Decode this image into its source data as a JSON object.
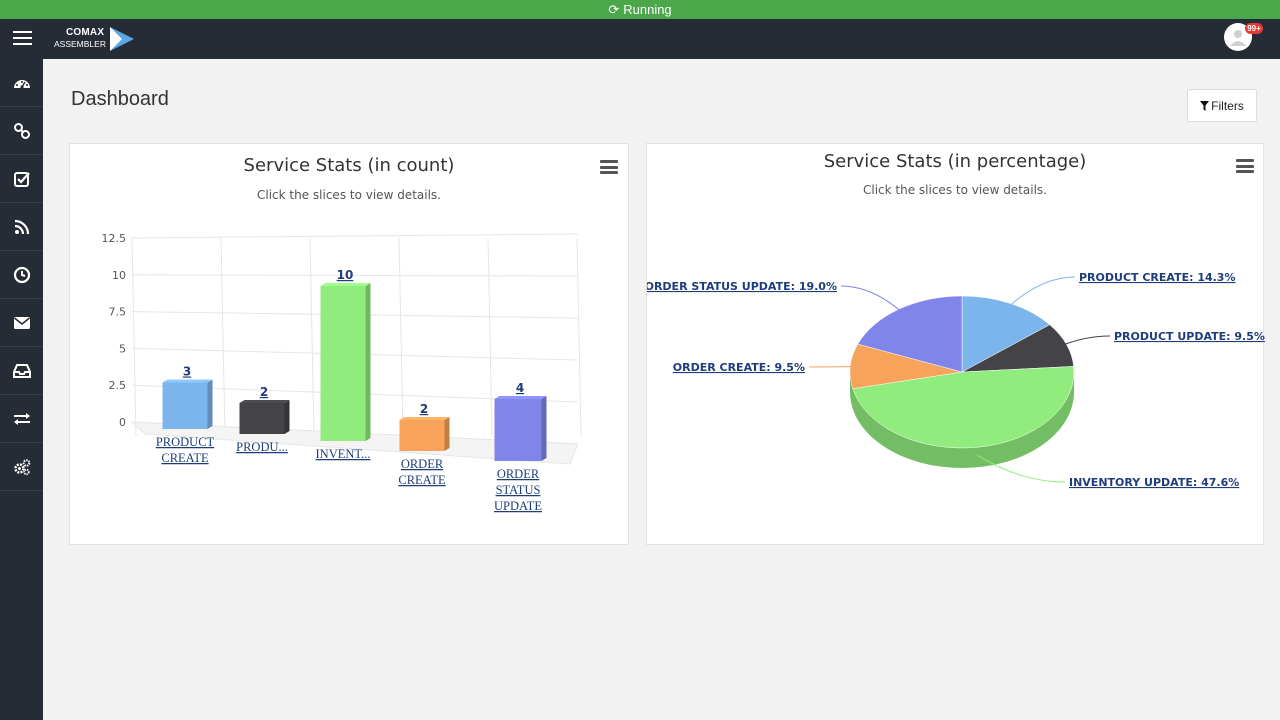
{
  "status": {
    "label": "Running"
  },
  "header": {
    "logo_line1": "COMAX",
    "logo_line2": "ASSEMBLER",
    "notification_count": "99+"
  },
  "sidebar": {
    "items": [
      "dashboard-icon",
      "link-icon",
      "check-square-icon",
      "rss-icon",
      "clock-icon",
      "envelope-icon",
      "inbox-icon",
      "exchange-icon",
      "cogs-icon"
    ]
  },
  "page": {
    "title": "Dashboard",
    "filters_label": "Filters"
  },
  "bar_panel": {
    "title": "Service Stats (in count)",
    "subtitle": "Click the slices to view details."
  },
  "pie_panel": {
    "title": "Service Stats (in percentage)",
    "subtitle": "Click the slices to view details."
  },
  "colors": {
    "green_bar": "#4aa84a",
    "dark": "#262c36"
  },
  "chart_data": [
    {
      "type": "bar",
      "title": "Service Stats (in count)",
      "subtitle": "Click the slices to view details.",
      "categories": [
        "PRODUCT CREATE",
        "PRODU...",
        "INVENT...",
        "ORDER CREATE",
        "ORDER STATUS UPDATE"
      ],
      "values": [
        3,
        2,
        10,
        2,
        4
      ],
      "colors": [
        "#7cb5ec",
        "#434348",
        "#90ed7d",
        "#f7a35c",
        "#8085e9"
      ],
      "yticks": [
        "0",
        "2.5",
        "5",
        "7.5",
        "10",
        "12.5"
      ],
      "ylim": [
        0,
        12.5
      ],
      "grid": true,
      "legend": "none"
    },
    {
      "type": "pie",
      "title": "Service Stats (in percentage)",
      "subtitle": "Click the slices to view details.",
      "slices": [
        {
          "label": "PRODUCT CREATE",
          "value": 14.3,
          "color": "#7cb5ec",
          "text": "PRODUCT CREATE: 14.3%"
        },
        {
          "label": "PRODUCT UPDATE",
          "value": 9.5,
          "color": "#434348",
          "text": "PRODUCT UPDATE: 9.5%"
        },
        {
          "label": "INVENTORY UPDATE",
          "value": 47.6,
          "color": "#90ed7d",
          "text": "INVENTORY UPDATE: 47.6%"
        },
        {
          "label": "ORDER CREATE",
          "value": 9.5,
          "color": "#f7a35c",
          "text": "ORDER CREATE: 9.5%"
        },
        {
          "label": "ORDER STATUS UPDATE",
          "value": 19.0,
          "color": "#8085e9",
          "text": "ORDER STATUS UPDATE: 19.0%"
        }
      ]
    }
  ]
}
